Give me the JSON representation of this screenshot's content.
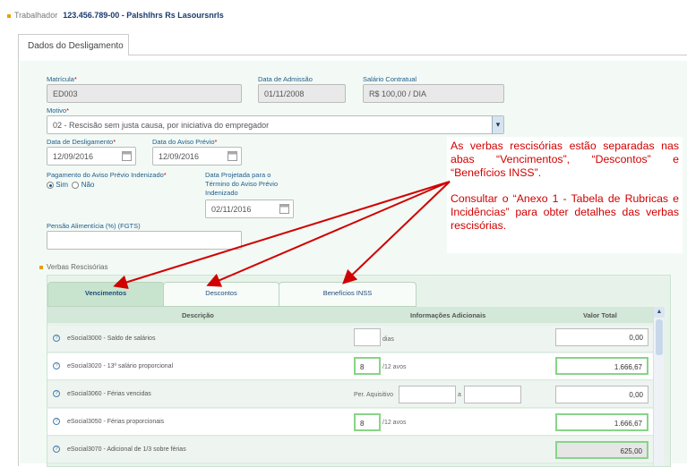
{
  "header": {
    "label": "Trabalhador",
    "value": "123.456.789-00 - Palshlhrs Rs Lasoursnrls"
  },
  "main_tab": "Dados do Desligamento",
  "form": {
    "matricula": {
      "label": "Matrícula",
      "value": "ED003"
    },
    "data_admissao": {
      "label": "Data de Admissão",
      "value": "01/11/2008"
    },
    "salario": {
      "label": "Salário Contratual",
      "value": "R$ 100,00 / DIA"
    },
    "motivo": {
      "label": "Motivo",
      "value": "02 - Rescisão sem justa causa, por iniciativa do empregador"
    },
    "data_desligamento": {
      "label": "Data de Desligamento",
      "value": "12/09/2016"
    },
    "data_aviso": {
      "label": "Data do Aviso Prévio",
      "value": "12/09/2016"
    },
    "pagamento_aviso": {
      "label": "Pagamento do Aviso Prévio Indenizado",
      "options": [
        "Sim",
        "Não"
      ],
      "selected": "Sim"
    },
    "data_projetada": {
      "label_1": "Data Projetada para o",
      "label_2": "Término do Aviso Prévio",
      "label_3": "Indenizado",
      "value": "02/11/2016"
    },
    "pensao": {
      "label": "Pensão Alimentícia (%) (FGTS)",
      "value": ""
    }
  },
  "verbas": {
    "section_title": "Verbas Rescisórias",
    "tabs": [
      "Vencimentos",
      "Descontos",
      "Benefícios INSS"
    ],
    "active_tab": "Vencimentos",
    "columns": [
      "Descrição",
      "Informações Adicionais",
      "Valor Total"
    ],
    "rows": [
      {
        "desc": "eSocial3000 - Saldo de salários",
        "info_value": "",
        "info_unit": "dias",
        "total": "0,00"
      },
      {
        "desc": "eSocial3020 - 13º salário proporcional",
        "info_value": "8",
        "info_unit": "/12 avos",
        "total": "1.666,67"
      },
      {
        "desc": "eSocial3060 - Férias vencidas",
        "info_label": "Per. Aquisitivo",
        "info_sep": "a",
        "total": "0,00"
      },
      {
        "desc": "eSocial3050 - Férias proporcionais",
        "info_value": "8",
        "info_unit": "/12 avos",
        "total": "1.666,67"
      },
      {
        "desc": "eSocial3070 - Adicional de 1/3 sobre férias",
        "total": "625,00"
      }
    ]
  },
  "note": {
    "p1": "As verbas rescisórias estão separadas nas abas “Vencimentos”, “Descontos” e “Benefícios INSS”.",
    "p2": "Consultar o “Anexo 1 - Tabela de Rubricas e Incidências” para obter detalhes das verbas rescisórias."
  },
  "colors": {
    "annotation": "#d10000",
    "accent": "#e8a000",
    "active_field": "#88d488"
  }
}
